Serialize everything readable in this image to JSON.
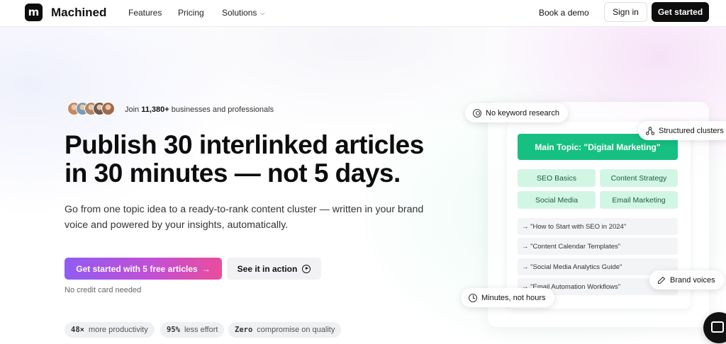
{
  "nav": {
    "logo_letter": "m",
    "brand": "Machined",
    "links": [
      "Features",
      "Pricing",
      "Solutions"
    ],
    "book_demo": "Book a demo",
    "sign_in": "Sign in",
    "get_started": "Get started"
  },
  "hero": {
    "join_prefix": "Join",
    "join_count": "11,380+",
    "join_suffix": "businesses and professionals",
    "headline": "Publish 30 interlinked articles in 30 minutes — not 5 days.",
    "subheadline": "Go from one topic idea to a ready-to-rank content cluster — written in your brand voice and powered by your insights, automatically.",
    "cta_primary": "Get started with 5 free articles",
    "cta_primary_icon": "→",
    "cta_secondary": "See it in action",
    "no_credit_card": "No credit card needed",
    "stats": [
      {
        "value": "48×",
        "label": "more productivity"
      },
      {
        "value": "95%",
        "label": "less effort"
      },
      {
        "value": "Zero",
        "label": "compromise on quality"
      }
    ],
    "avatar_colors": [
      "#c48a5c",
      "#7a9ab5",
      "#b28466",
      "#6d5a4e",
      "#a0694b"
    ]
  },
  "cluster": {
    "main_topic": "Main Topic: \"Digital Marketing\"",
    "subtopics": [
      "SEO Basics",
      "Content Strategy",
      "Social Media",
      "Email Marketing"
    ],
    "articles": [
      "→ \"How to Start with SEO in 2024\"",
      "→ \"Content Calendar Templates\"",
      "→ \"Social Media Analytics Guide\"",
      "→ \"Email Automation Workflows\""
    ],
    "badges": {
      "no_keyword": "No keyword research",
      "structured": "Structured clusters",
      "brand_voices": "Brand voices",
      "minutes": "Minutes, not hours"
    }
  },
  "colors": {
    "accent_green": "#16c083",
    "subtopic_bg": "#d2f6e4",
    "cta_gradient_start": "#8f5cf2",
    "cta_gradient_end": "#ea4d9b",
    "dark": "#0d0d0d"
  }
}
